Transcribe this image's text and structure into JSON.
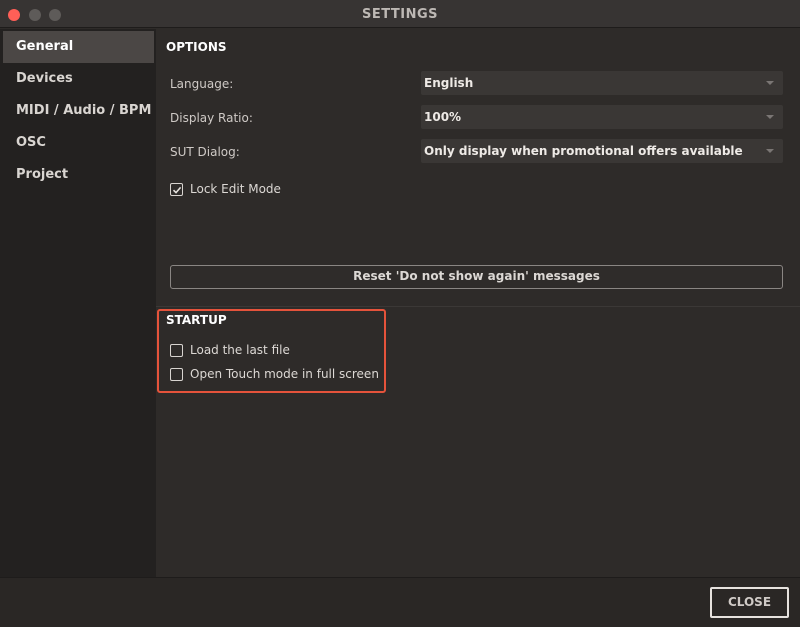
{
  "window": {
    "title": "SETTINGS"
  },
  "sidebar": {
    "items": [
      {
        "label": "General",
        "active": true
      },
      {
        "label": "Devices",
        "active": false
      },
      {
        "label": "MIDI / Audio / BPM",
        "active": false
      },
      {
        "label": "OSC",
        "active": false
      },
      {
        "label": "Project",
        "active": false
      }
    ]
  },
  "options": {
    "title": "OPTIONS",
    "language": {
      "label": "Language:",
      "value": "English"
    },
    "display_ratio": {
      "label": "Display Ratio:",
      "value": "100%"
    },
    "sut_dialog": {
      "label": "SUT Dialog:",
      "value": "Only display when promotional offers available"
    },
    "lock_edit_mode": {
      "label": "Lock Edit Mode",
      "checked": true
    },
    "reset_button": "Reset 'Do not show again' messages"
  },
  "startup": {
    "title": "STARTUP",
    "load_last_file": {
      "label": "Load the last file",
      "checked": false
    },
    "touch_fullscreen": {
      "label": "Open Touch mode in full screen",
      "checked": false
    },
    "highlight_color": "#e5533b"
  },
  "footer": {
    "close_label": "CLOSE"
  },
  "colors": {
    "background": "#2e2b29",
    "sidebar": "#232120",
    "active_item": "#4b4745",
    "close_dot": "#ff5f57"
  }
}
